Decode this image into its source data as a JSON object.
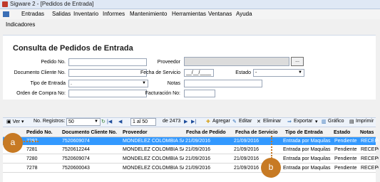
{
  "window": {
    "title": "Sigware 2 - [Pedidos de Entrada]"
  },
  "menu": [
    "Entradas",
    "Salidas",
    "Inventario",
    "Informes",
    "Mantenimiento",
    "Herramientas",
    "Ventanas",
    "Ayuda"
  ],
  "toolbar": {
    "indicadores": "Indicadores"
  },
  "form": {
    "heading": "Consulta de Pedidos de Entrada",
    "pedido_label": "Pedido No.",
    "documento_label": "Documento Cliente No.",
    "tipo_label": "Tipo de Entrada",
    "tipo_value": ".",
    "orden_label": "Orden de Compra No:",
    "proveedor_label": "Proveedor",
    "fecha_label": "Fecha de Servicio",
    "fecha_value": "__/__/____",
    "estado_label": "Estado",
    "estado_value": "-",
    "notas_label": "Notas",
    "facturacion_label": "Facturación No:",
    "dots": "..."
  },
  "navbar": {
    "ver": "Ver",
    "registros_label": "No. Registros:",
    "registros_value": "50",
    "page_pos": "1 al 50",
    "page_total": "de 2473",
    "agregar": "Agregar",
    "editar": "Editar",
    "eliminar": "Eliminar",
    "exportar": "Exportar",
    "grafico": "Gráfico",
    "imprimir": "Imprimir"
  },
  "grid": {
    "headers": [
      "Pedido No.",
      "Documento Cliente No.",
      "Proveedor",
      "Fecha de Pedido",
      "Fecha de Servicio",
      "Tipo de Entrada",
      "Estado",
      "Notas"
    ],
    "rows": [
      [
        "7282",
        "7520609074",
        "MONDELEZ COLOMBIA SAS",
        "21/09/2016",
        "21/09/2016",
        "Entrada por Maquilas",
        "Pendiente",
        "RECEPCI"
      ],
      [
        "7281",
        "7520612244",
        "MONDELEZ COLOMBIA SAS",
        "21/09/2016",
        "21/09/2016",
        "Entrada por Maquilas",
        "Pendiente",
        "RECEPCI"
      ],
      [
        "7280",
        "7520609074",
        "MONDELEZ COLOMBIA SAS",
        "21/09/2016",
        "21/09/2016",
        "Entrada por Maquilas",
        "Pendiente",
        "RECEPCI"
      ],
      [
        "7278",
        "7520600043",
        "MONDELEZ COLOMBIA SAS",
        "21/09/2016",
        "21/09/2016",
        "Entrada por Maquilas",
        "Pendiente",
        "RECEPCI"
      ]
    ]
  },
  "annotations": {
    "a": "a",
    "b": "b"
  },
  "colors": {
    "selection": "#3399ff",
    "badge": "#c77a24"
  }
}
